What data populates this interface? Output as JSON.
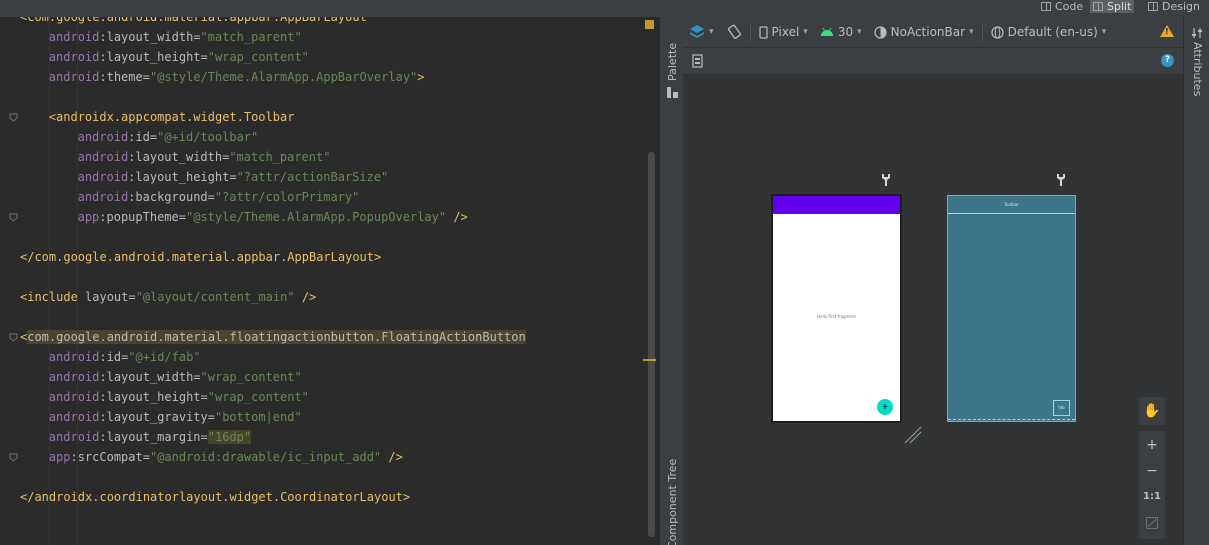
{
  "view_modes": {
    "code": "Code",
    "split": "Split",
    "design": "Design"
  },
  "editor": {
    "lines": [
      {
        "indent": "",
        "tokens": [
          [
            "p",
            "<"
          ],
          [
            "t",
            "com.google.android.material.appbar.AppBarLayout"
          ]
        ]
      },
      {
        "indent": "    ",
        "tokens": [
          [
            "ns",
            "android"
          ],
          [
            "at",
            ":layout_width"
          ],
          [
            "at",
            "="
          ],
          [
            "v",
            "\"match_parent\""
          ]
        ]
      },
      {
        "indent": "    ",
        "tokens": [
          [
            "ns",
            "android"
          ],
          [
            "at",
            ":layout_height"
          ],
          [
            "at",
            "="
          ],
          [
            "v",
            "\"wrap_content\""
          ]
        ]
      },
      {
        "indent": "    ",
        "tokens": [
          [
            "ns",
            "android"
          ],
          [
            "at",
            ":theme"
          ],
          [
            "at",
            "="
          ],
          [
            "v",
            "\"@style/Theme.AlarmApp.AppBarOverlay\""
          ],
          [
            "t",
            ">"
          ]
        ]
      },
      {
        "indent": "",
        "tokens": []
      },
      {
        "indent": "    ",
        "tokens": [
          [
            "t",
            "<androidx.appcompat.widget.Toolbar"
          ]
        ]
      },
      {
        "indent": "        ",
        "tokens": [
          [
            "ns",
            "android"
          ],
          [
            "at",
            ":id"
          ],
          [
            "at",
            "="
          ],
          [
            "v",
            "\"@+id/toolbar\""
          ]
        ]
      },
      {
        "indent": "        ",
        "tokens": [
          [
            "ns",
            "android"
          ],
          [
            "at",
            ":layout_width"
          ],
          [
            "at",
            "="
          ],
          [
            "v",
            "\"match_parent\""
          ]
        ]
      },
      {
        "indent": "        ",
        "tokens": [
          [
            "ns",
            "android"
          ],
          [
            "at",
            ":layout_height"
          ],
          [
            "at",
            "="
          ],
          [
            "v",
            "\"?attr/actionBarSize\""
          ]
        ]
      },
      {
        "indent": "        ",
        "tokens": [
          [
            "ns",
            "android"
          ],
          [
            "at",
            ":background"
          ],
          [
            "at",
            "="
          ],
          [
            "v",
            "\"?attr/colorPrimary\""
          ]
        ]
      },
      {
        "indent": "        ",
        "tokens": [
          [
            "ns",
            "app"
          ],
          [
            "at",
            ":popupTheme"
          ],
          [
            "at",
            "="
          ],
          [
            "v",
            "\"@style/Theme.AlarmApp.PopupOverlay\""
          ],
          [
            "at",
            " "
          ],
          [
            "t",
            "/>"
          ]
        ]
      },
      {
        "indent": "",
        "tokens": []
      },
      {
        "indent": "",
        "tokens": [
          [
            "t",
            "</com.google.android.material.appbar.AppBarLayout>"
          ]
        ]
      },
      {
        "indent": "",
        "tokens": []
      },
      {
        "indent": "",
        "tokens": [
          [
            "t",
            "<include "
          ],
          [
            "at",
            "layout"
          ],
          [
            "at",
            "="
          ],
          [
            "v",
            "\"@layout/content_main\""
          ],
          [
            "at",
            " "
          ],
          [
            "t",
            "/>"
          ]
        ]
      },
      {
        "indent": "",
        "tokens": []
      },
      {
        "indent": "",
        "tokens": [
          [
            "t",
            "<"
          ],
          [
            "hlbox",
            "com.google.android.material.floatingactionbutton.FloatingActionButton"
          ]
        ]
      },
      {
        "indent": "    ",
        "tokens": [
          [
            "ns",
            "android"
          ],
          [
            "at",
            ":id"
          ],
          [
            "at",
            "="
          ],
          [
            "v",
            "\"@+id/fab\""
          ]
        ]
      },
      {
        "indent": "    ",
        "tokens": [
          [
            "ns",
            "android"
          ],
          [
            "at",
            ":layout_width"
          ],
          [
            "at",
            "="
          ],
          [
            "v",
            "\"wrap_content\""
          ]
        ]
      },
      {
        "indent": "    ",
        "tokens": [
          [
            "ns",
            "android"
          ],
          [
            "at",
            ":layout_height"
          ],
          [
            "at",
            "="
          ],
          [
            "v",
            "\"wrap_content\""
          ]
        ]
      },
      {
        "indent": "    ",
        "tokens": [
          [
            "ns",
            "android"
          ],
          [
            "at",
            ":layout_gravity"
          ],
          [
            "at",
            "="
          ],
          [
            "v",
            "\"bottom|end\""
          ]
        ]
      },
      {
        "indent": "    ",
        "tokens": [
          [
            "ns",
            "android"
          ],
          [
            "at",
            ":layout_margin"
          ],
          [
            "at",
            "="
          ],
          [
            "vb",
            "\"16dp\""
          ]
        ]
      },
      {
        "indent": "    ",
        "tokens": [
          [
            "ns",
            "app"
          ],
          [
            "at",
            ":srcCompat"
          ],
          [
            "at",
            "="
          ],
          [
            "v",
            "\"@android:drawable/ic_input_add\""
          ],
          [
            "at",
            " "
          ],
          [
            "t",
            "/>"
          ]
        ]
      },
      {
        "indent": "",
        "tokens": []
      },
      {
        "indent": "",
        "tokens": [
          [
            "t",
            "</androidx.coordinatorlayout.widget.CoordinatorLayout>"
          ]
        ]
      }
    ]
  },
  "side_panels": {
    "palette": "Palette",
    "component_tree": "Component Tree",
    "attributes": "Attributes"
  },
  "design_toolbar": {
    "device": "Pixel",
    "api": "30",
    "theme": "NoActionBar",
    "locale": "Default (en-us)"
  },
  "preview": {
    "center_text": "Hello first fragment",
    "toolbar_label": "Toolbar",
    "fab_label": "fab",
    "fab_glyph": "+"
  },
  "zoom": {
    "plus": "+",
    "minus": "−",
    "one_to_one": "1:1"
  },
  "colors": {
    "primary": "#6200ee",
    "fab": "#03dac5",
    "blueprint": "#3c7688",
    "warning": "#e6a92a",
    "help": "#3592c4"
  }
}
